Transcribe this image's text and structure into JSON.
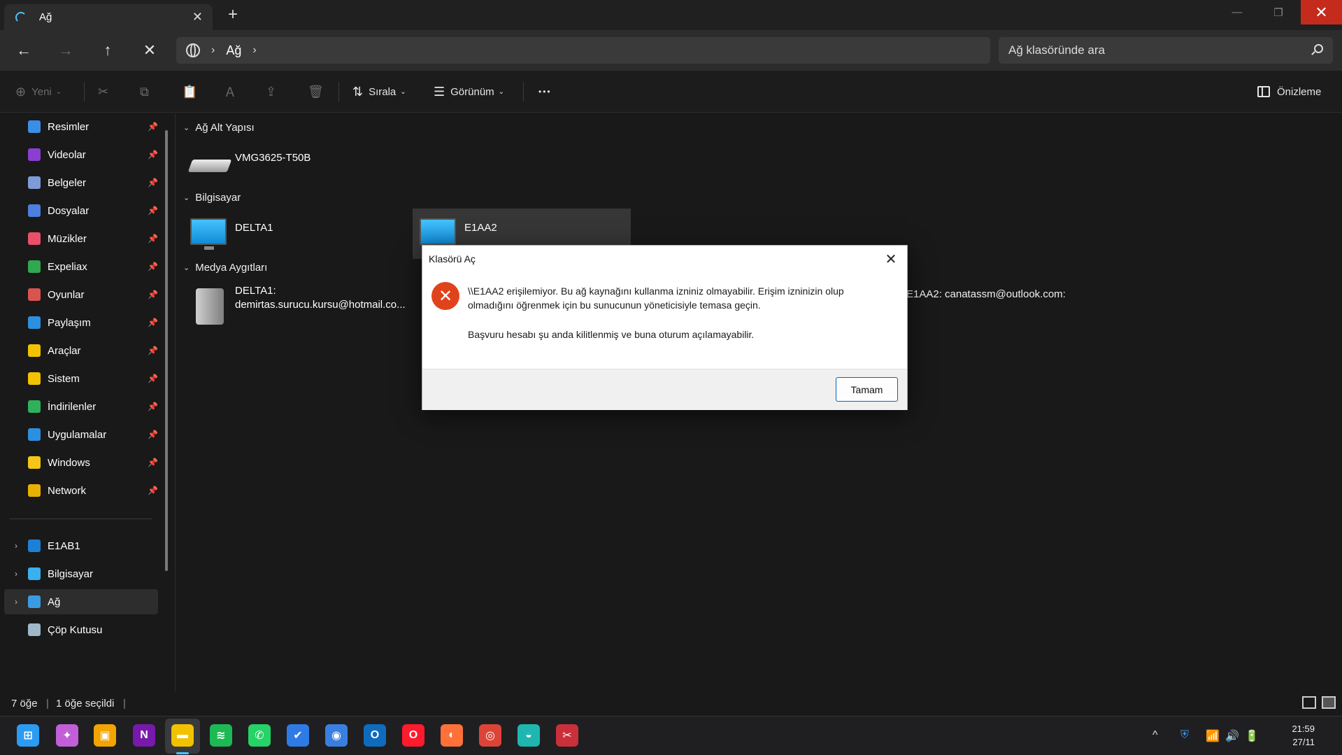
{
  "titlebar": {
    "tab_title": "Ağ",
    "close_glyph": "✕",
    "new_tab_glyph": "+",
    "controls": {
      "minimize": "—",
      "maximize": "❐",
      "close": "✕"
    }
  },
  "navigation": {
    "back": "←",
    "forward": "→",
    "up": "↑",
    "stop": "✕"
  },
  "address": {
    "crumb_sep": "›",
    "location": "Ağ",
    "trailing_chevron": "›"
  },
  "search": {
    "placeholder": "Ağ klasöründe ara"
  },
  "commandbar": {
    "new_label": "Yeni",
    "sort_label": "Sırala",
    "view_label": "Görünüm",
    "more_glyph": "•••",
    "preview_label": "Önizleme",
    "icons": {
      "new": "⊕",
      "cut": "✂",
      "copy": "⧉",
      "paste": "📋",
      "rename": "Ａ",
      "share": "⇪",
      "delete": "🗑",
      "sort": "⇅",
      "view": "☰",
      "dropdown": "⌄"
    }
  },
  "sidebar": {
    "pin_glyph": "📌",
    "quick_access": [
      {
        "label": "Resimler",
        "color": "#3a8ee6"
      },
      {
        "label": "Videolar",
        "color": "#8a3fd1"
      },
      {
        "label": "Belgeler",
        "color": "#7d9bd6"
      },
      {
        "label": "Dosyalar",
        "color": "#4c7fe0"
      },
      {
        "label": "Müzikler",
        "color": "#e8506a"
      },
      {
        "label": "Expeliax",
        "color": "#2fa84f"
      },
      {
        "label": "Oyunlar",
        "color": "#d9534f"
      },
      {
        "label": "Paylaşım",
        "color": "#2d8fe0"
      },
      {
        "label": "Araçlar",
        "color": "#f2c200"
      },
      {
        "label": "Sistem",
        "color": "#f2c200"
      },
      {
        "label": "İndirilenler",
        "color": "#2fb05b"
      },
      {
        "label": "Uygulamalar",
        "color": "#2d8fe0"
      },
      {
        "label": "Windows",
        "color": "#f5c518"
      },
      {
        "label": "Network",
        "color": "#e8b100"
      }
    ],
    "tree": [
      {
        "label": "E1AB1",
        "color": "#1e7fd6",
        "expander": "›"
      },
      {
        "label": "Bilgisayar",
        "color": "#3ab0ee",
        "expander": "›"
      },
      {
        "label": "Ağ",
        "color": "#3a9be0",
        "expander": "›"
      },
      {
        "label": "Çöp Kutusu",
        "color": "#9fb7c9",
        "expander": ""
      }
    ]
  },
  "content": {
    "group_chevron": "⌄",
    "groups": [
      {
        "title": "Ağ Alt Yapısı"
      },
      {
        "title": "Bilgisayar"
      },
      {
        "title": "Medya Aygıtları"
      }
    ],
    "infrastructure_device": "VMG3625-T50B",
    "computers": [
      "DELTA1",
      "E1AA2"
    ],
    "media_devices": {
      "delta_line1": "DELTA1:",
      "delta_line2": "demirtas.surucu.kursu@hotmail.co...",
      "e1aa2_label": "E1AA2: canatassm@outlook.com:"
    }
  },
  "dialog": {
    "title": "Klasörü Aç",
    "close_glyph": "✕",
    "error_glyph": "✕",
    "message": "\\\\E1AA2 erişilemiyor. Bu ağ kaynağını kullanma izniniz olmayabilir. Erişim izninizin olup olmadığını öğrenmek için bu sunucunun yöneticisiyle temasa geçin.",
    "detail": "Başvuru hesabı şu anda kilitlenmiş ve buna oturum açılamayabilir.",
    "ok_label": "Tamam"
  },
  "statusbar": {
    "item_count": "7 öğe",
    "selection": "1 öğe seçildi",
    "sep": "|"
  },
  "taskbar": {
    "icons": [
      {
        "name": "start",
        "glyph": "⊞",
        "color": "#2b9cf2"
      },
      {
        "name": "copilot",
        "glyph": "✦",
        "color": "#c25fd8"
      },
      {
        "name": "store",
        "glyph": "▣",
        "color": "#f2a400"
      },
      {
        "name": "onenote",
        "glyph": "N",
        "color": "#7719aa"
      },
      {
        "name": "explorer",
        "glyph": "▬",
        "color": "#f2c200"
      },
      {
        "name": "spotify",
        "glyph": "≋",
        "color": "#1db954"
      },
      {
        "name": "whatsapp",
        "glyph": "✆",
        "color": "#25d366"
      },
      {
        "name": "todo",
        "glyph": "✔",
        "color": "#2f7be5"
      },
      {
        "name": "chat",
        "glyph": "◉",
        "color": "#3a7fe0"
      },
      {
        "name": "outlook",
        "glyph": "O",
        "color": "#0f6cbd"
      },
      {
        "name": "opera",
        "glyph": "O",
        "color": "#ff1b2d"
      },
      {
        "name": "firefox",
        "glyph": "◐",
        "color": "#ff7139"
      },
      {
        "name": "chrome",
        "glyph": "◎",
        "color": "#db4437"
      },
      {
        "name": "edge",
        "glyph": "◒",
        "color": "#1fb6b0"
      },
      {
        "name": "snipping",
        "glyph": "✂",
        "color": "#c9303a"
      }
    ],
    "tray": {
      "chevron": "^",
      "shield": "⛨",
      "wifi": "📶",
      "volume": "🔊",
      "battery": "🔋"
    },
    "time": "21:59",
    "date": "27/11"
  }
}
